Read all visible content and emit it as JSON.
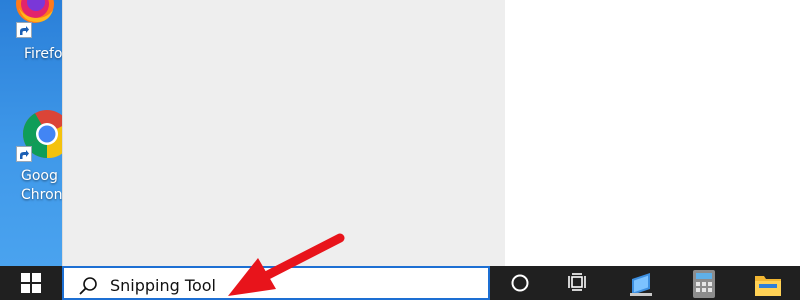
{
  "desktop": {
    "icons": [
      {
        "label": "Firefo",
        "icon": "firefox-icon"
      },
      {
        "label": "Goog\nChron",
        "icon": "chrome-icon"
      }
    ]
  },
  "search": {
    "value": "Snipping Tool"
  },
  "taskbar": {
    "icons": [
      "windows-start-icon",
      "search-icon",
      "cortana-icon",
      "task-view-icon",
      "network-display-icon",
      "calculator-icon",
      "file-explorer-icon"
    ]
  },
  "annotation": {
    "arrow_color": "#e8141b"
  }
}
